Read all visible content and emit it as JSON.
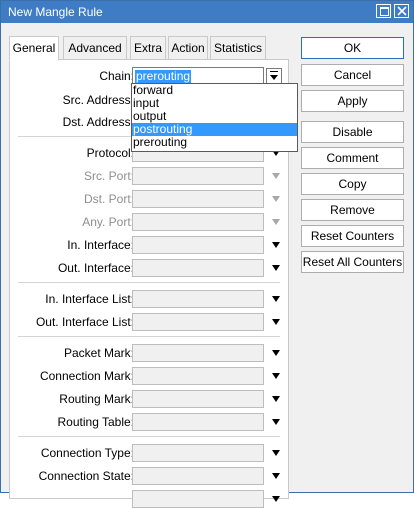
{
  "window": {
    "title": "New Mangle Rule"
  },
  "tabs": [
    "General",
    "Advanced",
    "Extra",
    "Action",
    "Statistics"
  ],
  "chain": {
    "label": "Chain:",
    "value": "prerouting",
    "options": [
      "forward",
      "input",
      "output",
      "postrouting",
      "prerouting"
    ],
    "highlighted": "postrouting"
  },
  "fields": {
    "src_address": "Src. Address:",
    "dst_address": "Dst. Address:",
    "protocol": "Protocol:",
    "src_port": "Src. Port:",
    "dst_port": "Dst. Port:",
    "any_port": "Any. Port:",
    "in_interface": "In. Interface:",
    "out_interface": "Out. Interface:",
    "in_interface_list": "In. Interface List:",
    "out_interface_list": "Out. Interface List:",
    "packet_mark": "Packet Mark:",
    "connection_mark": "Connection Mark:",
    "routing_mark": "Routing Mark:",
    "routing_table": "Routing Table:",
    "connection_type": "Connection Type:",
    "connection_state": "Connection State:"
  },
  "buttons": {
    "ok": "OK",
    "cancel": "Cancel",
    "apply": "Apply",
    "disable": "Disable",
    "comment": "Comment",
    "copy": "Copy",
    "remove": "Remove",
    "reset_counters": "Reset Counters",
    "reset_all_counters": "Reset All Counters"
  }
}
